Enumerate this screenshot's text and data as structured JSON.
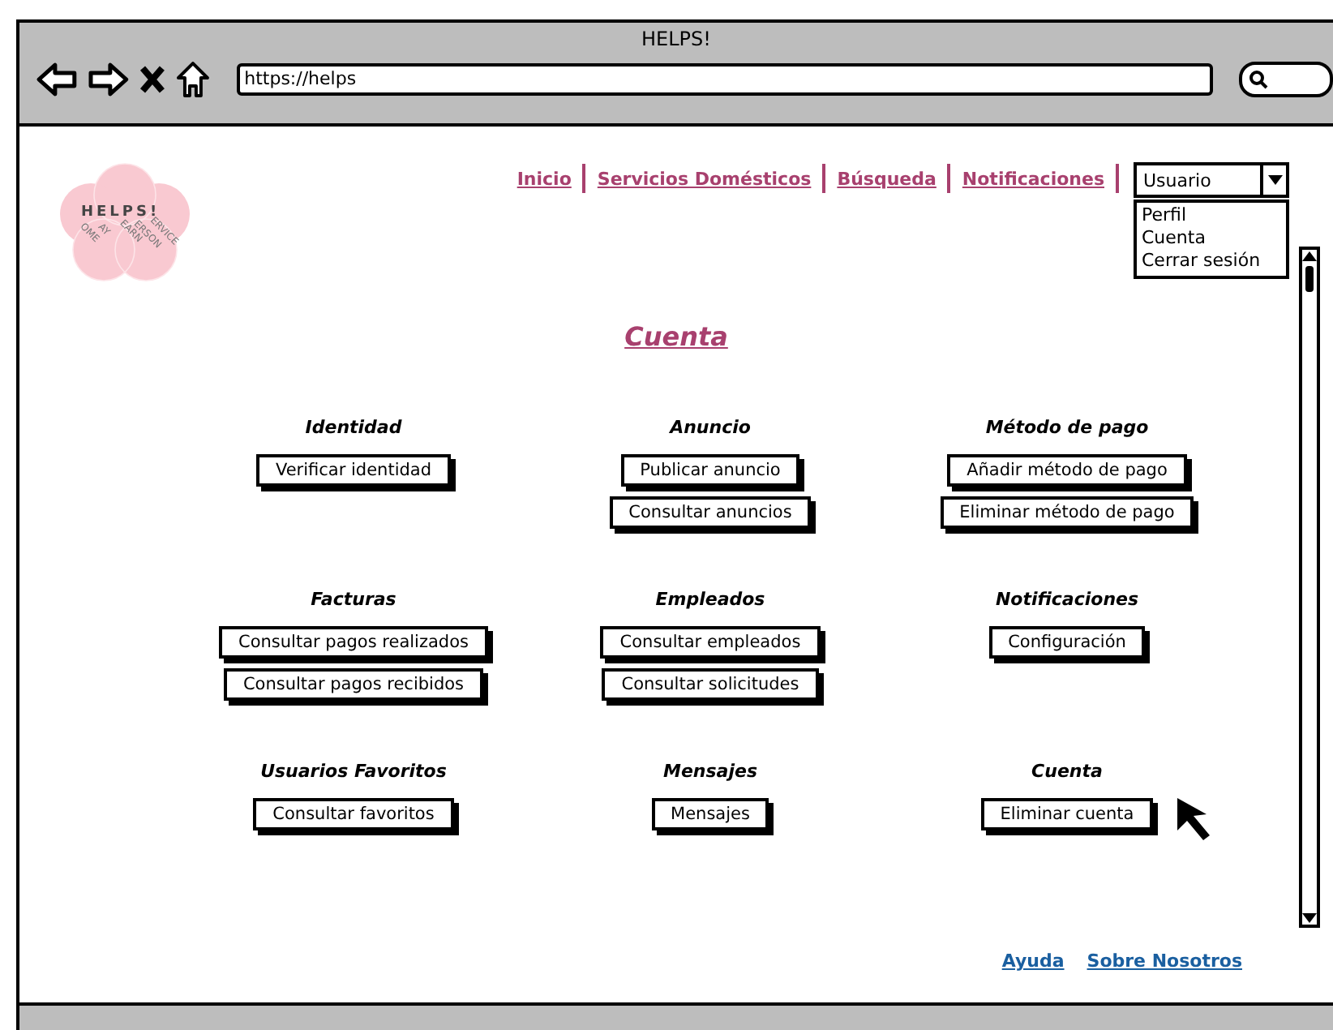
{
  "window": {
    "title": "HELPS!"
  },
  "browser": {
    "url": "https://helps"
  },
  "logo": {
    "title": "HELPS!",
    "words": [
      "OME",
      "AY",
      "EARN",
      "ERSON",
      "ERVICE"
    ]
  },
  "nav": {
    "links": [
      "Inicio",
      "Servicios Domésticos",
      "Búsqueda",
      "Notificaciones"
    ]
  },
  "user_menu": {
    "value": "Usuario",
    "expanded": true,
    "options": [
      "Perfil",
      "Cuenta",
      "Cerrar sesión"
    ]
  },
  "page_title": "Cuenta",
  "sections": [
    {
      "title": "Identidad",
      "buttons": [
        "Verificar identidad"
      ]
    },
    {
      "title": "Anuncio",
      "buttons": [
        "Publicar anuncio",
        "Consultar anuncios"
      ]
    },
    {
      "title": "Método de pago",
      "buttons": [
        "Añadir método de pago",
        "Eliminar método de pago"
      ]
    },
    {
      "title": "Facturas",
      "buttons": [
        "Consultar pagos realizados",
        "Consultar pagos recibidos"
      ]
    },
    {
      "title": "Empleados",
      "buttons": [
        "Consultar empleados",
        "Consultar solicitudes"
      ]
    },
    {
      "title": "Notificaciones",
      "buttons": [
        "Configuración"
      ]
    },
    {
      "title": "Usuarios Favoritos",
      "buttons": [
        "Consultar favoritos"
      ]
    },
    {
      "title": "Mensajes",
      "buttons": [
        "Mensajes"
      ]
    },
    {
      "title": "Cuenta",
      "buttons": [
        "Eliminar cuenta"
      ]
    }
  ],
  "footer": {
    "links": [
      "Ayuda",
      "Sobre Nosotros"
    ]
  }
}
